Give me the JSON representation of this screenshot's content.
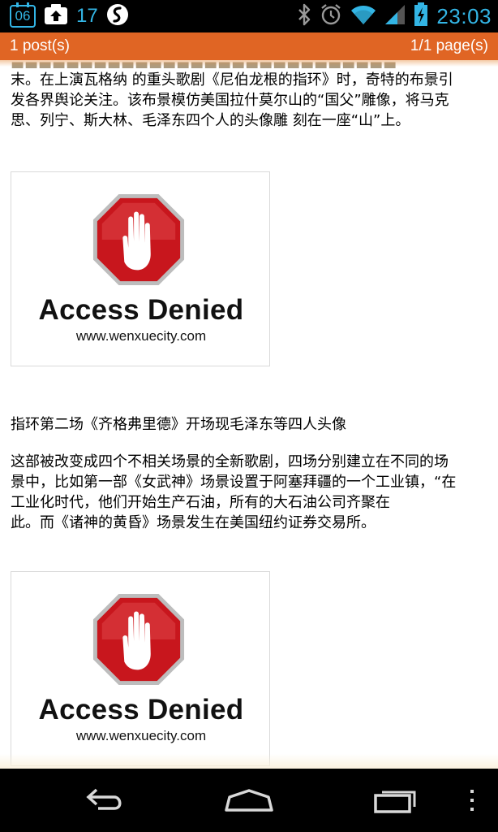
{
  "status_bar": {
    "calendar_day": "06",
    "temperature": "17",
    "time": "23:03",
    "icons": [
      "calendar-icon",
      "upload-icon",
      "shazam-icon",
      "bluetooth-icon",
      "alarm-icon",
      "wifi-icon",
      "signal-icon",
      "battery-charging-icon"
    ],
    "accent_color": "#33b5e5"
  },
  "post_bar": {
    "post_count": "1 post(s)",
    "page_count": "1/1 page(s)",
    "color": "#e06524"
  },
  "article": {
    "para1_line1": "末。在上演瓦格纳 的重头歌剧《尼伯龙根的指环》时，奇特的布景引",
    "para1_line2": "发各界舆论关注。该布景模仿美国拉什莫尔山的“国父”雕像，将马克",
    "para1_line3": "思、列宁、斯大林、毛泽东四个人的头像雕 刻在一座“山”上。",
    "caption": "指环第二场《齐格弗里德》开场现毛泽东等四人头像",
    "para2_line1": "这部被改变成四个不相关场景的全新歌剧，四场分别建立在不同的场",
    "para2_line2": "景中，比如第一部《女武神》场景设置于阿塞拜疆的一个工业镇，“在",
    "para2_line3": "工业化时代，他们开始生产石油，所有的大石油公司齐聚在",
    "para2_line4": "此。而《诸神的黄昏》场景发生在美国纽约证券交易所。"
  },
  "images": [
    {
      "title": "Access Denied",
      "site": "www.wenxuecity.com"
    },
    {
      "title": "Access Denied",
      "site": "www.wenxuecity.com"
    }
  ],
  "nav_bar": {
    "buttons": [
      "back-icon",
      "home-icon",
      "recent-apps-icon",
      "menu-icon"
    ]
  }
}
